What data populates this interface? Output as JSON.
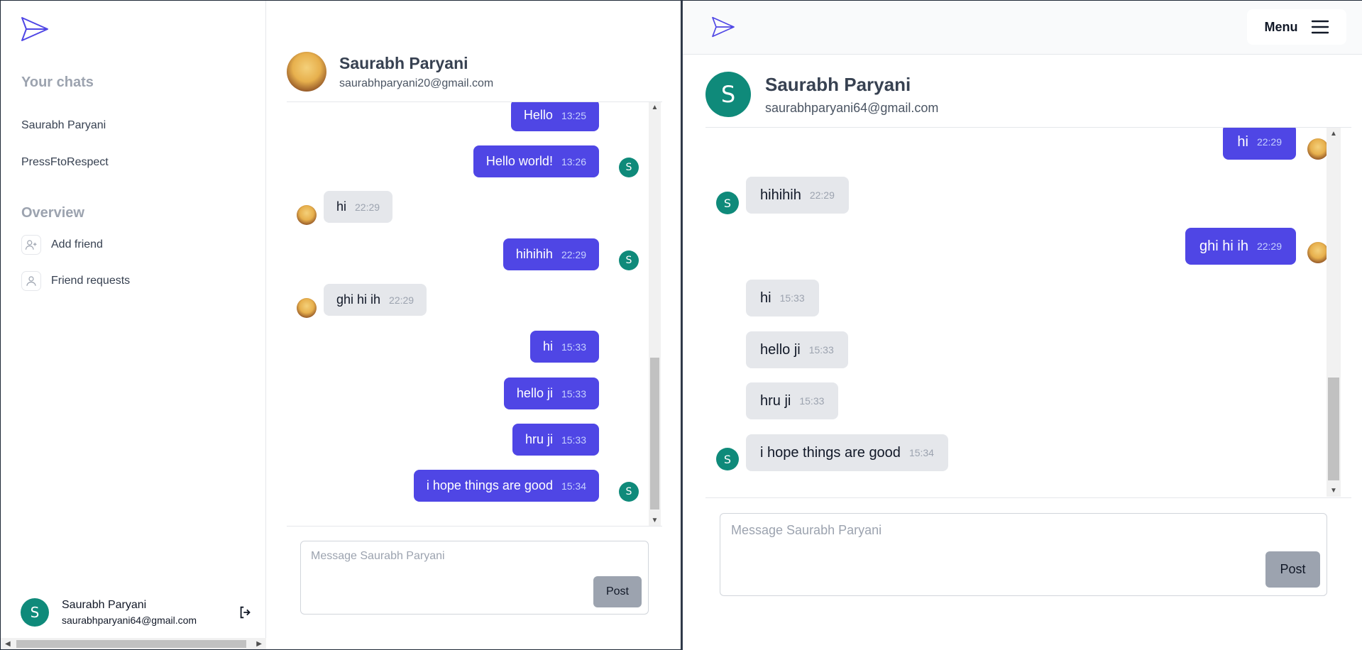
{
  "left": {
    "sidebar": {
      "your_chats_title": "Your chats",
      "chats": [
        "Saurabh Paryani",
        "PressFtoRespect"
      ],
      "overview_title": "Overview",
      "overview_items": [
        {
          "label": "Add friend",
          "icon": "user-plus-icon"
        },
        {
          "label": "Friend requests",
          "icon": "user-icon"
        }
      ],
      "current_user": {
        "initial": "S",
        "name": "Saurabh Paryani",
        "email": "saurabhparyani64@gmail.com"
      }
    },
    "chat": {
      "partner_name": "Saurabh Paryani",
      "partner_email": "saurabhparyani20@gmail.com",
      "messages": [
        {
          "text": "Hello",
          "time": "13:25",
          "from": "me"
        },
        {
          "text": "Hello world!",
          "time": "13:26",
          "from": "me"
        },
        {
          "text": "hi",
          "time": "22:29",
          "from": "them"
        },
        {
          "text": "hihihih",
          "time": "22:29",
          "from": "me"
        },
        {
          "text": "ghi hi ih",
          "time": "22:29",
          "from": "them"
        },
        {
          "text": "hi",
          "time": "15:33",
          "from": "me"
        },
        {
          "text": "hello ji",
          "time": "15:33",
          "from": "me"
        },
        {
          "text": "hru ji",
          "time": "15:33",
          "from": "me"
        },
        {
          "text": "i hope things are good",
          "time": "15:34",
          "from": "me"
        }
      ],
      "my_avatar_initial": "S",
      "input_placeholder": "Message Saurabh Paryani",
      "post_label": "Post"
    }
  },
  "right": {
    "menu_label": "Menu",
    "chat": {
      "partner_initial": "S",
      "partner_name": "Saurabh Paryani",
      "partner_email": "saurabhparyani64@gmail.com",
      "messages": [
        {
          "text": "hi",
          "time": "22:29",
          "from": "me"
        },
        {
          "text": "hihihih",
          "time": "22:29",
          "from": "them"
        },
        {
          "text": "ghi hi ih",
          "time": "22:29",
          "from": "me"
        },
        {
          "text": "hi",
          "time": "15:33",
          "from": "them"
        },
        {
          "text": "hello ji",
          "time": "15:33",
          "from": "them"
        },
        {
          "text": "hru ji",
          "time": "15:33",
          "from": "them"
        },
        {
          "text": "i hope things are good",
          "time": "15:34",
          "from": "them"
        }
      ],
      "their_avatar_initial": "S",
      "input_placeholder": "Message Saurabh Paryani",
      "post_label": "Post"
    }
  },
  "colors": {
    "accent": "#4f46e5",
    "avatar": "#0f8a7a",
    "bubble_other": "#e5e7eb",
    "post_button": "#9ca3af"
  }
}
